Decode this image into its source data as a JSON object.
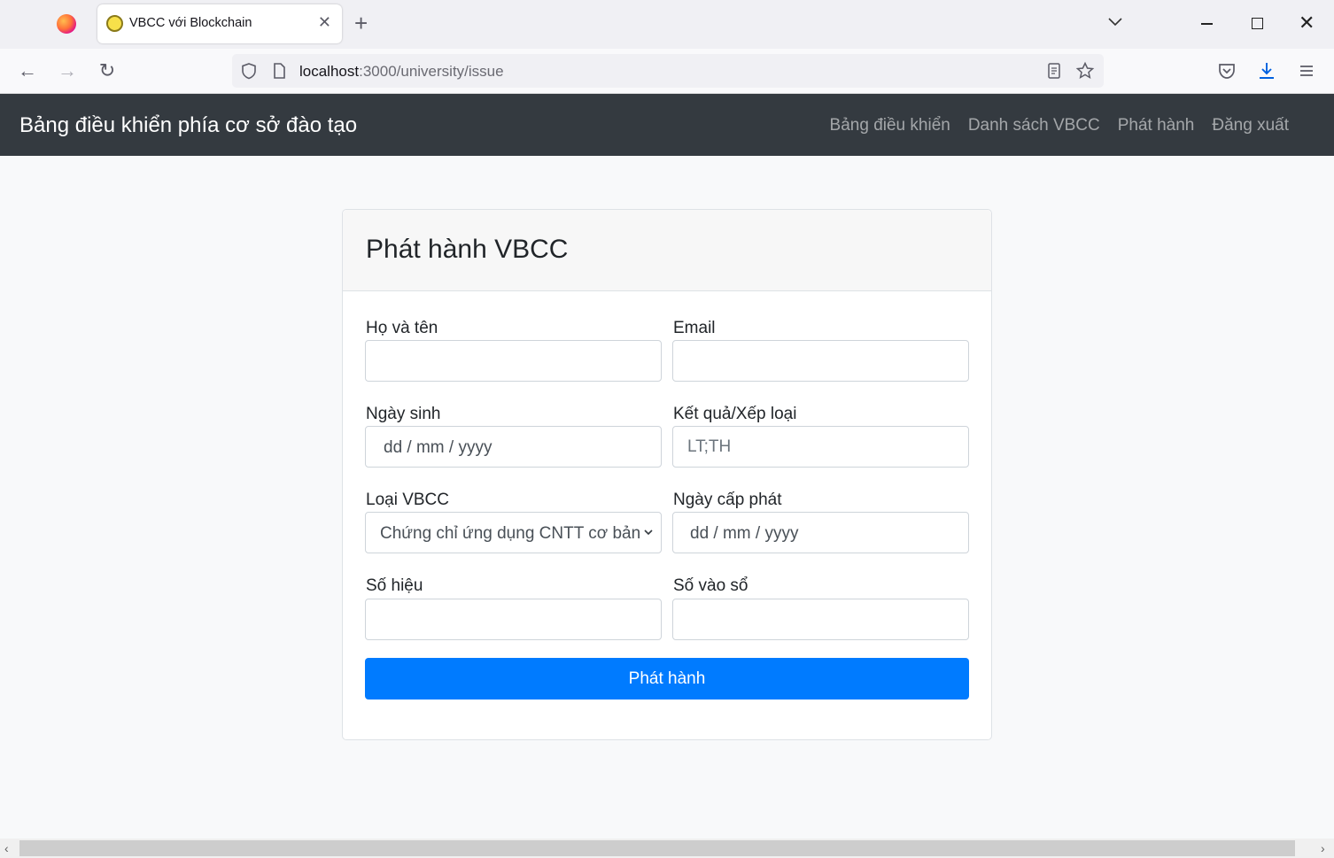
{
  "browser": {
    "tab_title": "VBCC với Blockchain",
    "url_host": "localhost",
    "url_path": ":3000/university/issue"
  },
  "nav": {
    "brand": "Bảng điều khiển phía cơ sở đào tạo",
    "links": [
      "Bảng điều khiển",
      "Danh sách VBCC",
      "Phát hành",
      "Đăng xuất"
    ]
  },
  "form": {
    "title": "Phát hành VBCC",
    "fullname_label": "Họ và tên",
    "email_label": "Email",
    "dob_label": "Ngày sinh",
    "dob_placeholder": "dd / mm / yyyy",
    "result_label": "Kết quả/Xếp loại",
    "result_placeholder": "LT;TH",
    "type_label": "Loại VBCC",
    "type_value": "Chứng chỉ ứng dụng CNTT cơ bản",
    "issue_date_label": "Ngày cấp phát",
    "issue_date_placeholder": "dd / mm / yyyy",
    "serial_label": "Số hiệu",
    "registry_label": "Số vào sổ",
    "submit_label": "Phát hành"
  }
}
